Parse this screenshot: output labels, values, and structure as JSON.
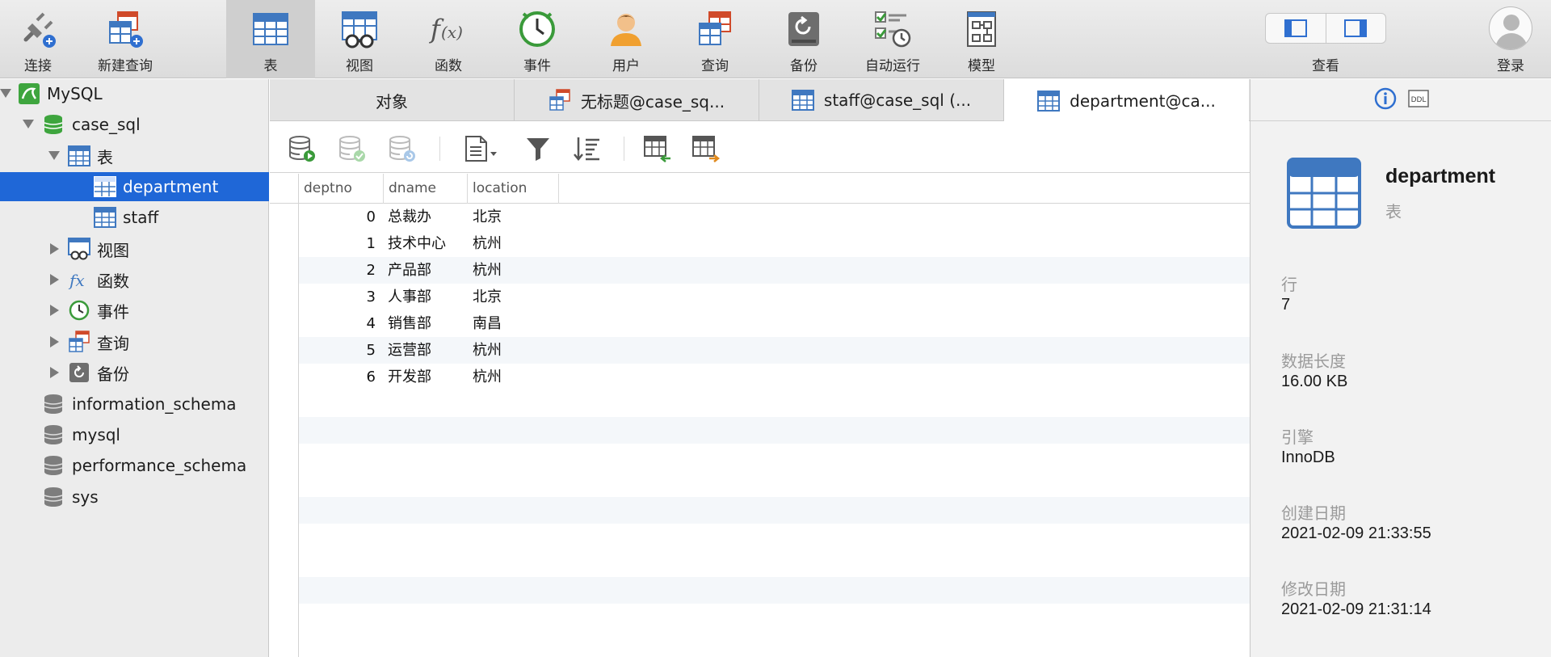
{
  "toolbar": {
    "items": [
      {
        "label": "连接",
        "icon": "connect-plug-icon"
      },
      {
        "label": "新建查询",
        "icon": "new-query-icon"
      },
      {
        "label": "表",
        "icon": "table-icon"
      },
      {
        "label": "视图",
        "icon": "view-icon"
      },
      {
        "label": "函数",
        "icon": "function-icon"
      },
      {
        "label": "事件",
        "icon": "event-clock-icon"
      },
      {
        "label": "用户",
        "icon": "user-icon"
      },
      {
        "label": "查询",
        "icon": "query-icon"
      },
      {
        "label": "备份",
        "icon": "backup-icon"
      },
      {
        "label": "自动运行",
        "icon": "automation-icon"
      },
      {
        "label": "模型",
        "icon": "model-icon"
      }
    ],
    "active": "表",
    "view_label": "查看",
    "login_label": "登录"
  },
  "sidebar": {
    "connection": "MySQL",
    "database": "case_sql",
    "tables_group": "表",
    "tables": [
      "department",
      "staff"
    ],
    "selected_table": "department",
    "groups": [
      "视图",
      "函数",
      "事件",
      "查询",
      "备份"
    ],
    "other_databases": [
      "information_schema",
      "mysql",
      "performance_schema",
      "sys"
    ]
  },
  "tabs": [
    {
      "label": "对象",
      "active": false
    },
    {
      "label": "无标题@case_sq...",
      "active": false
    },
    {
      "label": "staff@case_sql (...",
      "active": false
    },
    {
      "label": "department@ca...",
      "active": true
    }
  ],
  "grid": {
    "columns": [
      "deptno",
      "dname",
      "location"
    ],
    "rows": [
      [
        "0",
        "总裁办",
        "北京"
      ],
      [
        "1",
        "技术中心",
        "杭州"
      ],
      [
        "2",
        "产品部",
        "杭州"
      ],
      [
        "3",
        "人事部",
        "北京"
      ],
      [
        "4",
        "销售部",
        "南昌"
      ],
      [
        "5",
        "运营部",
        "杭州"
      ],
      [
        "6",
        "开发部",
        "杭州"
      ]
    ]
  },
  "info": {
    "ddl_label": "DDL",
    "name": "department",
    "type": "表",
    "fields": [
      {
        "label": "行",
        "value": "7"
      },
      {
        "label": "数据长度",
        "value": "16.00 KB"
      },
      {
        "label": "引擎",
        "value": "InnoDB"
      },
      {
        "label": "创建日期",
        "value": "2021-02-09 21:33:55"
      },
      {
        "label": "修改日期",
        "value": "2021-02-09 21:31:14"
      }
    ]
  },
  "colors": {
    "selection": "#1f67d7",
    "table_blue": "#3f78c0",
    "green_db": "#3ea53e"
  }
}
